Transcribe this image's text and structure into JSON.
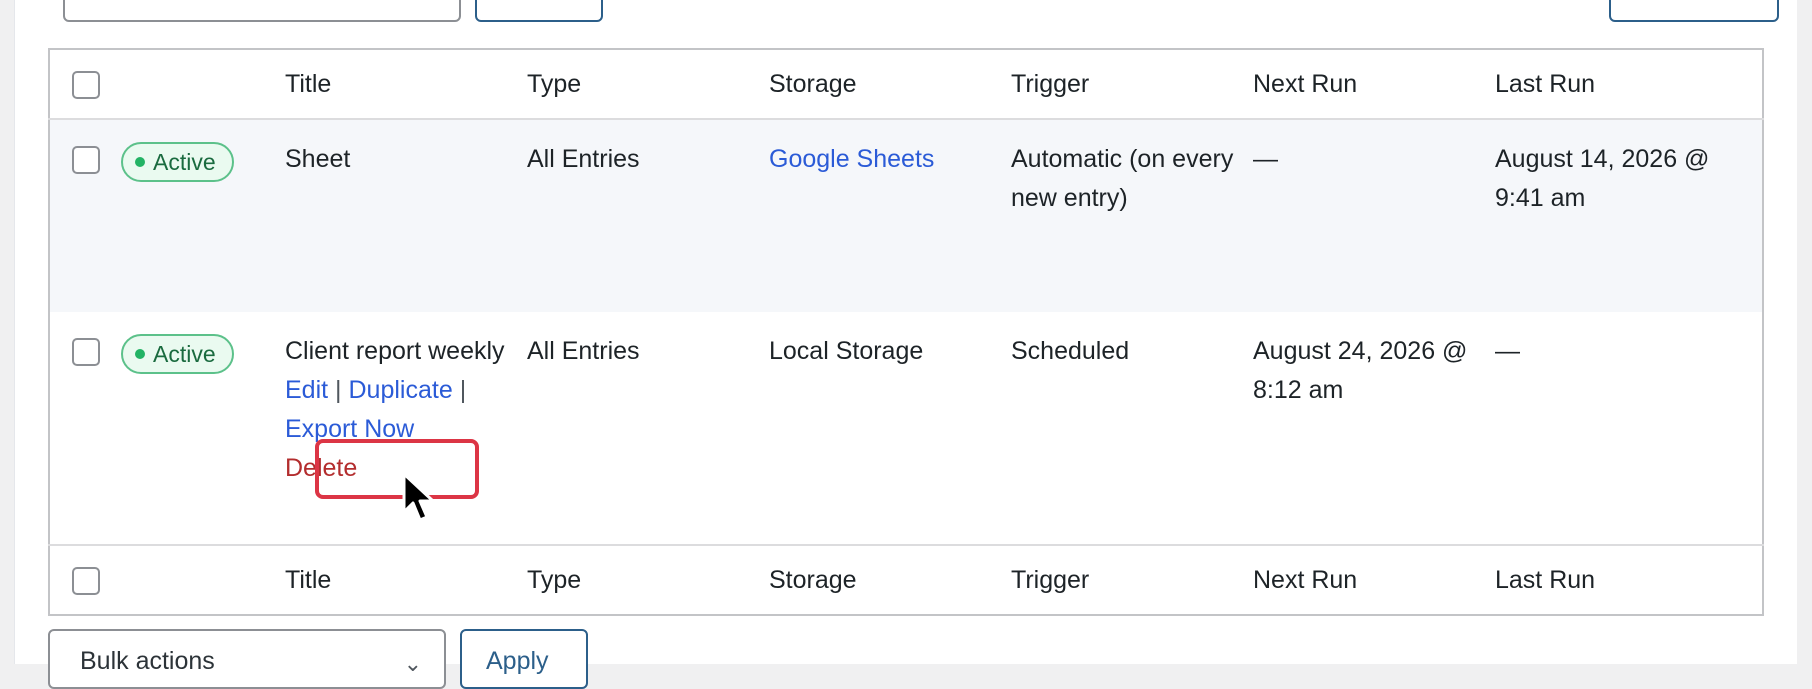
{
  "table": {
    "columns": [
      "Title",
      "Type",
      "Storage",
      "Trigger",
      "Next Run",
      "Last Run"
    ],
    "rows": [
      {
        "status": "Active",
        "title": "Sheet",
        "type": "All Entries",
        "storage": "Google Sheets",
        "trigger": "Automatic (on every new entry)",
        "next_run": "—",
        "last_run": "August 14, 2026 @ 9:41 am"
      },
      {
        "status": "Active",
        "title": "Client report weekly",
        "type": "All Entries",
        "storage": "Local Storage",
        "trigger": "Scheduled",
        "next_run": "August 24, 2026 @ 8:12 am",
        "last_run": "—",
        "row_actions": {
          "edit": "Edit",
          "duplicate": "Duplicate",
          "export_now": "Export Now",
          "delete": "Delete",
          "separator": "|"
        }
      }
    ]
  },
  "bulk": {
    "select_label": "Bulk actions",
    "apply_label": "Apply"
  },
  "colors": {
    "link": "#2b5bd7",
    "active_badge": "#22b364",
    "delete": "#b32d2e",
    "highlight": "#dc3545"
  }
}
